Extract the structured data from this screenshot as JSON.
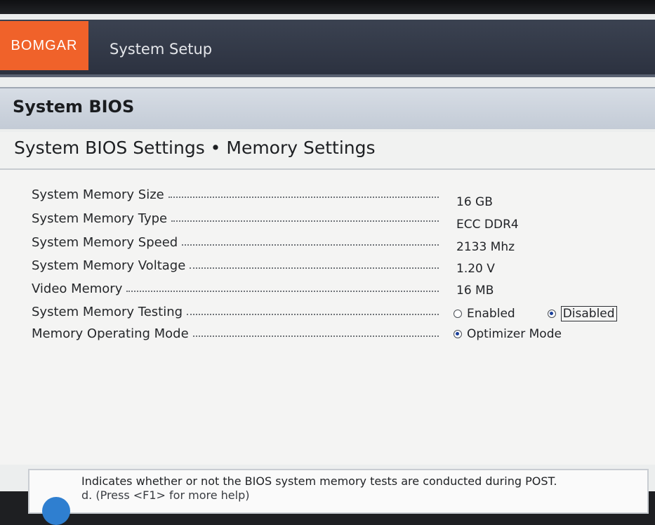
{
  "brand": {
    "logo_text": "BOMGAR"
  },
  "app": {
    "title": "System Setup"
  },
  "section": {
    "title": "System BIOS"
  },
  "page": {
    "title": "System BIOS Settings • Memory Settings"
  },
  "settings": [
    {
      "label": "System Memory Size",
      "value": "16 GB"
    },
    {
      "label": "System Memory Type",
      "value": "ECC DDR4"
    },
    {
      "label": "System Memory Speed",
      "value": "2133 Mhz"
    },
    {
      "label": "System Memory Voltage",
      "value": "1.20 V"
    },
    {
      "label": "Video Memory",
      "value": "16 MB"
    },
    {
      "label": "System Memory Testing",
      "options": [
        "Enabled",
        "Disabled"
      ],
      "selected": "Disabled"
    },
    {
      "label": "Memory Operating Mode",
      "options": [
        "Optimizer Mode"
      ],
      "selected": "Optimizer Mode"
    }
  ],
  "help": {
    "line1": "Indicates whether or not the BIOS system memory tests are conducted during POST.",
    "line2": "d. (Press <F1> for more help)"
  },
  "colors": {
    "brand_orange": "#f0622a",
    "header_dark": "#2c3240",
    "radio_selected": "#1a3f9a"
  }
}
